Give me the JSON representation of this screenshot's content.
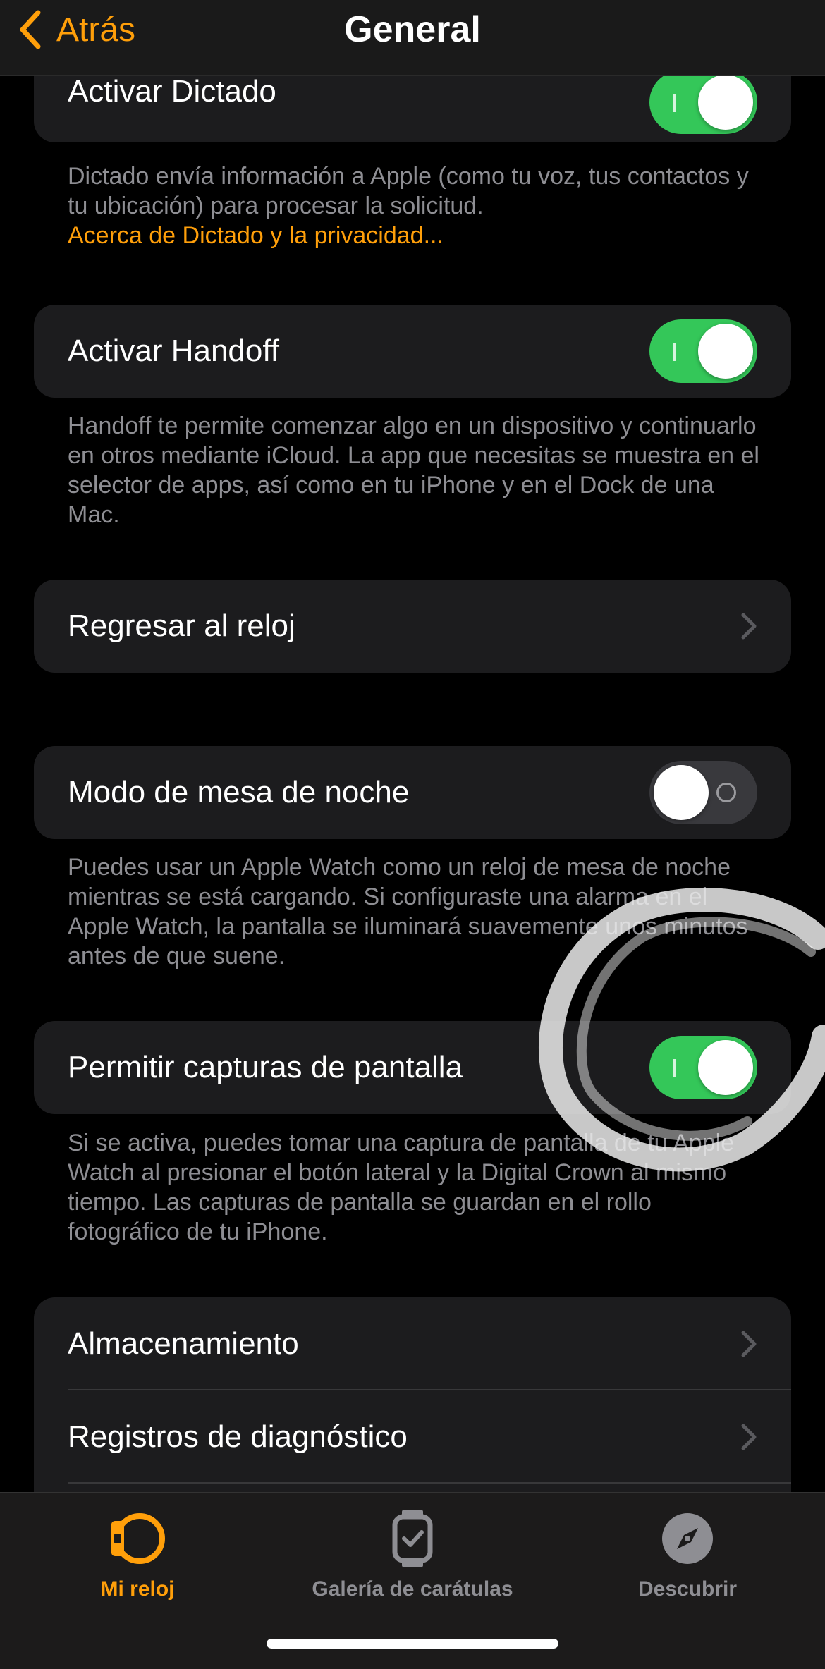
{
  "nav": {
    "back_label": "Atrás",
    "title": "General"
  },
  "sections": {
    "dictation": {
      "label": "Activar Dictado",
      "toggle_on": true,
      "footnote": "Dictado envía información a Apple (como tu voz, tus contactos y tu ubicación) para procesar la solicitud.",
      "footnote_link": "Acerca de Dictado y la privacidad..."
    },
    "handoff": {
      "label": "Activar Handoff",
      "toggle_on": true,
      "footnote": "Handoff te permite comenzar algo en un dispositivo y continuarlo en otros mediante iCloud. La app que necesitas se muestra en el selector de apps, así como en tu iPhone y en el Dock de una Mac."
    },
    "return_to_clock": {
      "label": "Regresar al reloj"
    },
    "nightstand": {
      "label": "Modo de mesa de noche",
      "toggle_on": false,
      "footnote": "Puedes usar un Apple Watch como un reloj de mesa de noche mientras se está cargando. Si configuraste una alarma en el Apple Watch, la pantalla se iluminará suavemente unos minutos antes de que suene."
    },
    "screenshots": {
      "label": "Permitir capturas de pantalla",
      "toggle_on": true,
      "footnote": "Si se activa, puedes tomar una captura de pantalla de tu Apple Watch al presionar el botón lateral y la Digital Crown al mismo tiempo. Las capturas de pantalla se guardan en el rollo fotográfico de tu iPhone."
    },
    "storage_group": {
      "items": [
        {
          "label": "Almacenamiento"
        },
        {
          "label": "Registros de diagnóstico"
        }
      ]
    }
  },
  "tabbar": {
    "tabs": [
      {
        "label": "Mi reloj",
        "icon": "watch-icon",
        "active": true
      },
      {
        "label": "Galería de carátulas",
        "icon": "watch-face-gallery-icon",
        "active": false
      },
      {
        "label": "Descubrir",
        "icon": "compass-icon",
        "active": false
      }
    ]
  },
  "colors": {
    "accent": "#ff9f0a",
    "toggle_on": "#34c759",
    "card_bg": "#1c1c1e",
    "footnote": "#8e8e93"
  }
}
